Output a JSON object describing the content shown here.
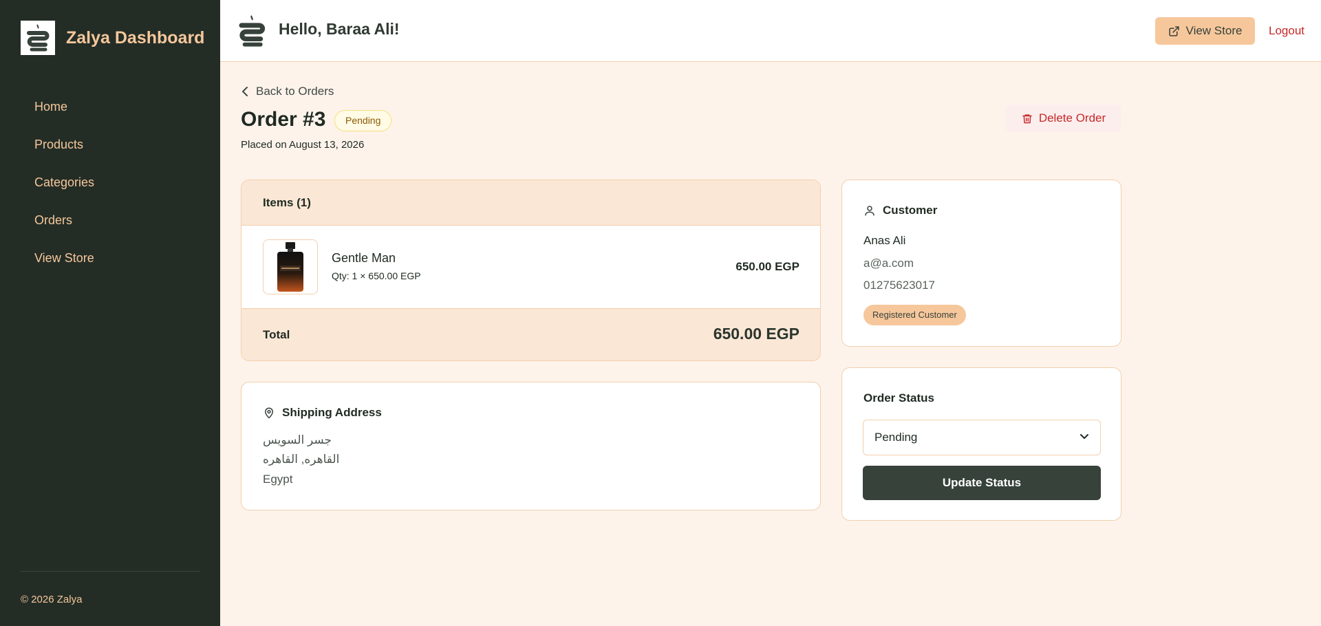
{
  "sidebar": {
    "brand": "Zalya Dashboard",
    "nav": [
      {
        "label": "Home"
      },
      {
        "label": "Products"
      },
      {
        "label": "Categories"
      },
      {
        "label": "Orders"
      },
      {
        "label": "View Store"
      }
    ],
    "copyright": "© 2026 Zalya"
  },
  "header": {
    "greeting": "Hello, Baraa Ali!",
    "view_store": "View Store",
    "logout": "Logout"
  },
  "order": {
    "back_link": "Back to Orders",
    "title": "Order #3",
    "status_badge": "Pending",
    "placed_on": "Placed on August 13, 2026",
    "delete_label": "Delete Order",
    "items_header": "Items (1)",
    "items": [
      {
        "name": "Gentle Man",
        "qty_line": "Qty: 1 × 650.00 EGP",
        "price": "650.00 EGP",
        "image_icon": "perfume-bottle-icon"
      }
    ],
    "total_label": "Total",
    "total_value": "650.00 EGP"
  },
  "shipping": {
    "title": "Shipping Address",
    "lines": [
      "جسر السويس",
      "القاهره, القاهره",
      "Egypt"
    ]
  },
  "customer": {
    "title": "Customer",
    "name": "Anas Ali",
    "email": "a@a.com",
    "phone": "01275623017",
    "badge": "Registered Customer"
  },
  "status_panel": {
    "title": "Order Status",
    "selected": "Pending",
    "update_label": "Update Status"
  },
  "colors": {
    "sidebar_bg": "#232d26",
    "accent": "#f6c79b",
    "page_bg": "#fdf3eb",
    "danger": "#c62828",
    "primary_button": "#36423a"
  }
}
